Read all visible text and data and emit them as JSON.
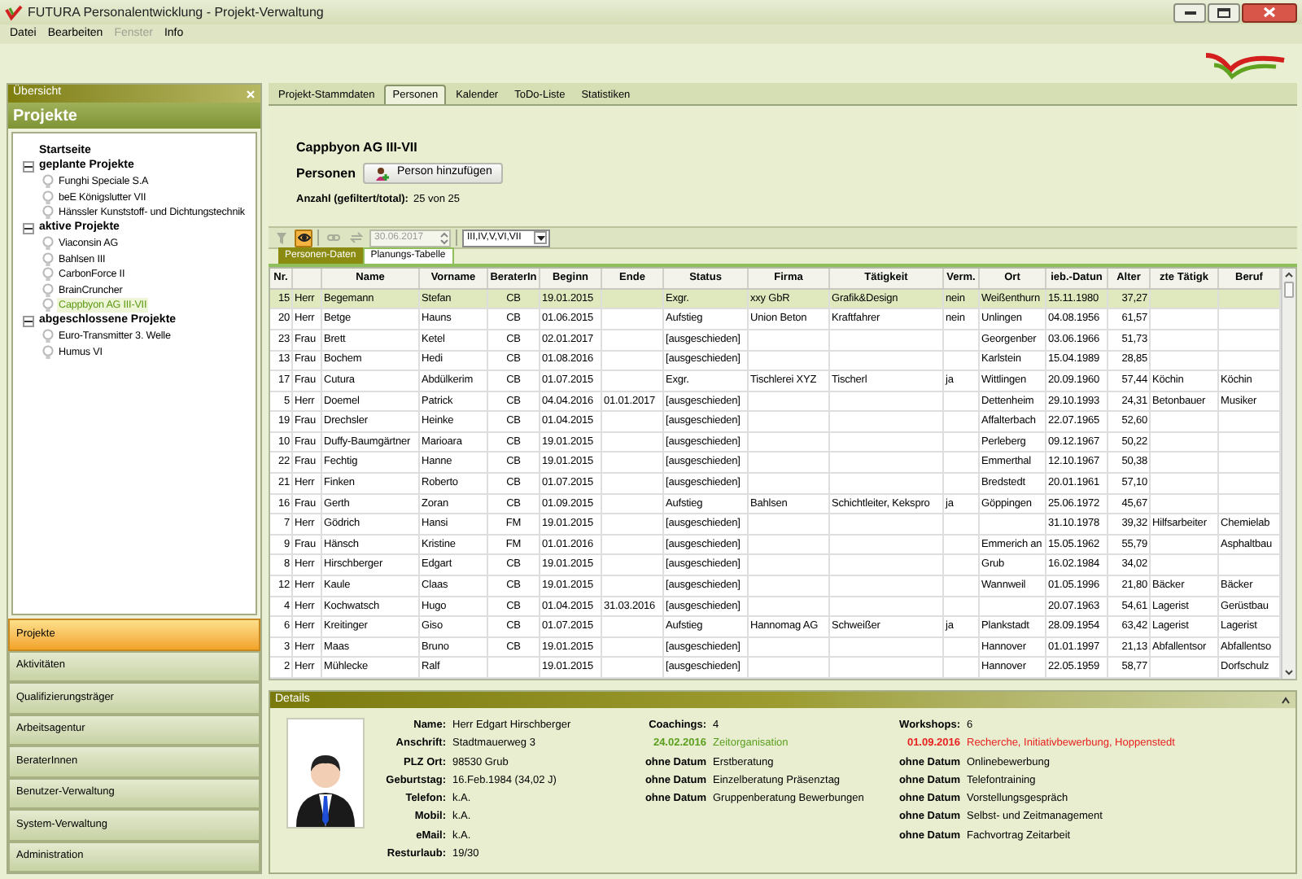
{
  "window": {
    "title": "FUTURA Personalentwicklung - Projekt-Verwaltung"
  },
  "menu": [
    {
      "label": "Datei",
      "disabled": false
    },
    {
      "label": "Bearbeiten",
      "disabled": false
    },
    {
      "label": "Fenster",
      "disabled": true
    },
    {
      "label": "Info",
      "disabled": false
    }
  ],
  "sidebar": {
    "header": "Übersicht",
    "title": "Projekte",
    "tree": [
      {
        "label": "Startseite",
        "kind": "page"
      },
      {
        "label": "geplante Projekte",
        "kind": "group",
        "expanded": true,
        "children": [
          {
            "label": "Funghi Speciale S.A",
            "selected": false
          },
          {
            "label": "beE Königslutter VII",
            "selected": false
          },
          {
            "label": "Hänssler Kunststoff- und Dichtungstechnik",
            "selected": false
          }
        ]
      },
      {
        "label": "aktive Projekte",
        "kind": "group",
        "expanded": true,
        "children": [
          {
            "label": "Viaconsin AG",
            "selected": false
          },
          {
            "label": "Bahlsen III",
            "selected": false
          },
          {
            "label": "CarbonForce II",
            "selected": false
          },
          {
            "label": "BrainCruncher",
            "selected": false
          },
          {
            "label": "Cappbyon AG III-VII",
            "selected": true
          }
        ]
      },
      {
        "label": "abgeschlossene Projekte",
        "kind": "group",
        "expanded": true,
        "children": [
          {
            "label": "Euro-Transmitter 3. Welle",
            "selected": false
          },
          {
            "label": "Humus VI",
            "selected": false
          }
        ]
      }
    ],
    "nav": [
      {
        "label": "Projekte",
        "selected": true
      },
      {
        "label": "Aktivitäten",
        "selected": false
      },
      {
        "label": "Qualifizierungsträger",
        "selected": false
      },
      {
        "label": "Arbeitsagentur",
        "selected": false
      },
      {
        "label": "BeraterInnen",
        "selected": false
      },
      {
        "label": "Benutzer-Verwaltung",
        "selected": false
      },
      {
        "label": "System-Verwaltung",
        "selected": false
      },
      {
        "label": "Administration",
        "selected": false
      }
    ]
  },
  "tabs": [
    {
      "label": "Projekt-Stammdaten",
      "selected": false
    },
    {
      "label": "Personen",
      "selected": true
    },
    {
      "label": "Kalender",
      "selected": false
    },
    {
      "label": "ToDo-Liste",
      "selected": false
    },
    {
      "label": "Statistiken",
      "selected": false
    }
  ],
  "project": {
    "title": "Cappbyon AG III-VII",
    "section": "Personen",
    "add_button": "Person hinzufügen",
    "count_label": "Anzahl (gefiltert/total):",
    "count": "25 von 25"
  },
  "toolbar": {
    "buttons": [
      {
        "kind": "filter",
        "disabled": true,
        "on": false
      },
      {
        "kind": "view",
        "disabled": false,
        "on": true
      },
      {
        "kind": "link",
        "disabled": true,
        "on": false
      },
      {
        "kind": "transfer",
        "disabled": true,
        "on": false
      }
    ],
    "date": "30.06.2017",
    "date_disabled": true,
    "phase_filter": "III,IV,V,VI,VII"
  },
  "subtabs": [
    {
      "label": "Personen-Daten",
      "selected": true
    },
    {
      "label": "Planungs-Tabelle",
      "selected": false
    }
  ],
  "table": {
    "columns": [
      "Nr.",
      "",
      "Name",
      "Vorname",
      "BeraterIn",
      "Beginn",
      "Ende",
      "Status",
      "Firma",
      "Tätigkeit",
      "Verm.",
      "Ort",
      "ieb.-Datun",
      "Alter",
      "zte Tätigk",
      "Beruf"
    ],
    "rows": [
      {
        "selected": true,
        "cells": [
          "15",
          "Herr",
          "Begemann",
          "Stefan",
          "CB",
          "19.01.2015",
          null,
          "Exgr.",
          "xxy GbR",
          "Grafik&Design",
          "nein",
          "Weißenthurn",
          "15.11.1980",
          "37,27",
          null,
          null
        ]
      },
      {
        "selected": false,
        "cells": [
          "20",
          "Herr",
          "Betge",
          "Hauns",
          "CB",
          "01.06.2015",
          null,
          "Aufstieg",
          "Union Beton",
          "Kraftfahrer",
          "nein",
          "Unlingen",
          "04.08.1956",
          "61,57",
          null,
          null
        ]
      },
      {
        "selected": false,
        "cells": [
          "23",
          "Frau",
          "Brett",
          "Ketel",
          "CB",
          "02.01.2017",
          null,
          "[ausgeschieden]",
          null,
          null,
          null,
          "Georgenber",
          "03.06.1966",
          "51,73",
          null,
          null
        ]
      },
      {
        "selected": false,
        "cells": [
          "13",
          "Frau",
          "Bochem",
          "Hedi",
          "CB",
          "01.08.2016",
          null,
          "[ausgeschieden]",
          null,
          null,
          null,
          "Karlstein",
          "15.04.1989",
          "28,85",
          null,
          null
        ]
      },
      {
        "selected": false,
        "cells": [
          "17",
          "Frau",
          "Cutura",
          "Abdülkerim",
          "CB",
          "01.07.2015",
          null,
          "Exgr.",
          "Tischlerei XYZ",
          "Tischerl",
          "ja",
          "Wittlingen",
          "20.09.1960",
          "57,44",
          "Köchin",
          "Köchin"
        ]
      },
      {
        "selected": false,
        "cells": [
          "5",
          "Herr",
          "Doemel",
          "Patrick",
          "CB",
          "04.04.2016",
          "01.01.2017",
          "[ausgeschieden]",
          null,
          null,
          null,
          "Dettenheim",
          "29.10.1993",
          "24,31",
          "Betonbauer",
          "Musiker"
        ]
      },
      {
        "selected": false,
        "cells": [
          "19",
          "Frau",
          "Drechsler",
          "Heinke",
          "CB",
          "01.04.2015",
          null,
          "[ausgeschieden]",
          null,
          null,
          null,
          "Affalterbach",
          "22.07.1965",
          "52,60",
          null,
          null
        ]
      },
      {
        "selected": false,
        "cells": [
          "10",
          "Frau",
          "Duffy-Baumgärtner",
          "Marioara",
          "CB",
          "19.01.2015",
          null,
          "[ausgeschieden]",
          null,
          null,
          null,
          "Perleberg",
          "09.12.1967",
          "50,22",
          null,
          null
        ]
      },
      {
        "selected": false,
        "cells": [
          "22",
          "Frau",
          "Fechtig",
          "Hanne",
          "CB",
          "19.01.2015",
          null,
          "[ausgeschieden]",
          null,
          null,
          null,
          "Emmerthal",
          "12.10.1967",
          "50,38",
          null,
          null
        ]
      },
      {
        "selected": false,
        "cells": [
          "21",
          "Herr",
          "Finken",
          "Roberto",
          "CB",
          "01.07.2015",
          null,
          "[ausgeschieden]",
          null,
          null,
          null,
          "Bredstedt",
          "20.01.1961",
          "57,10",
          null,
          null
        ]
      },
      {
        "selected": false,
        "cells": [
          "16",
          "Frau",
          "Gerth",
          "Zoran",
          "CB",
          "01.09.2015",
          null,
          "Aufstieg",
          "Bahlsen",
          "Schichtleiter, Kekspro",
          "ja",
          "Göppingen",
          "25.06.1972",
          "45,67",
          null,
          null
        ]
      },
      {
        "selected": false,
        "cells": [
          "7",
          "Herr",
          "Gödrich",
          "Hansi",
          "FM",
          "19.01.2015",
          null,
          "[ausgeschieden]",
          null,
          null,
          null,
          null,
          "31.10.1978",
          "39,32",
          "Hilfsarbeiter",
          "Chemielab"
        ]
      },
      {
        "selected": false,
        "cells": [
          "9",
          "Frau",
          "Hänsch",
          "Kristine",
          "FM",
          "01.01.2016",
          null,
          "[ausgeschieden]",
          null,
          null,
          null,
          "Emmerich an",
          "15.05.1962",
          "55,79",
          null,
          "Asphaltbau"
        ]
      },
      {
        "selected": false,
        "cells": [
          "8",
          "Herr",
          "Hirschberger",
          "Edgart",
          "CB",
          "19.01.2015",
          null,
          "[ausgeschieden]",
          null,
          null,
          null,
          "Grub",
          "16.02.1984",
          "34,02",
          null,
          null
        ]
      },
      {
        "selected": false,
        "cells": [
          "12",
          "Herr",
          "Kaule",
          "Claas",
          "CB",
          "19.01.2015",
          null,
          "[ausgeschieden]",
          null,
          null,
          null,
          "Wannweil",
          "01.05.1996",
          "21,80",
          "Bäcker",
          "Bäcker"
        ]
      },
      {
        "selected": false,
        "cells": [
          "4",
          "Herr",
          "Kochwatsch",
          "Hugo",
          "CB",
          "01.04.2015",
          "31.03.2016",
          "[ausgeschieden]",
          null,
          null,
          null,
          null,
          "20.07.1963",
          "54,61",
          "Lagerist",
          "Gerüstbau"
        ]
      },
      {
        "selected": false,
        "cells": [
          "6",
          "Herr",
          "Kreitinger",
          "Giso",
          "CB",
          "01.07.2015",
          null,
          "Aufstieg",
          "Hannomag AG",
          "Schweißer",
          "ja",
          "Plankstadt",
          "28.09.1954",
          "63,42",
          "Lagerist",
          "Lagerist"
        ]
      },
      {
        "selected": false,
        "cells": [
          "3",
          "Herr",
          "Maas",
          "Bruno",
          "CB",
          "19.01.2015",
          null,
          "[ausgeschieden]",
          null,
          null,
          null,
          "Hannover",
          "01.01.1997",
          "21,13",
          "Abfallentsor",
          "Abfallentso"
        ]
      },
      {
        "selected": false,
        "cells": [
          "2",
          "Herr",
          "Mühlecke",
          "Ralf",
          null,
          "19.01.2015",
          null,
          "[ausgeschieden]",
          null,
          null,
          null,
          "Hannover",
          "22.05.1959",
          "58,77",
          null,
          "Dorfschulz"
        ]
      }
    ]
  },
  "details": {
    "title": "Details",
    "fields": [
      {
        "label": "Name:",
        "value": "Herr Edgart Hirschberger"
      },
      {
        "label": "Anschrift:",
        "value": "Stadtmauerweg 3"
      },
      {
        "label": "PLZ Ort:",
        "value": "98530 Grub"
      },
      {
        "label": "Geburtstag:",
        "value": "16.Feb.1984 (34,02 J)"
      },
      {
        "label": "Telefon:",
        "value": "k.A."
      },
      {
        "label": "Mobil:",
        "value": "k.A."
      },
      {
        "label": "eMail:",
        "value": "k.A."
      },
      {
        "label": "Resturlaub:",
        "value": "19/30"
      }
    ],
    "coachings": {
      "label": "Coachings:",
      "count": "4",
      "items": [
        {
          "date": "24.02.2016",
          "text": "Zeitorganisation",
          "color": "#5a9e1e"
        },
        {
          "date": "ohne Datum",
          "text": "Erstberatung",
          "color": "#000000"
        },
        {
          "date": "ohne Datum",
          "text": "Einzelberatung Präsenztag",
          "color": "#000000"
        },
        {
          "date": "ohne Datum",
          "text": "Gruppenberatung Bewerbungen",
          "color": "#000000"
        }
      ]
    },
    "workshops": {
      "label": "Workshops:",
      "count": "6",
      "items": [
        {
          "date": "01.09.2016",
          "text": "Recherche, Initiativbewerbung, Hoppenstedt",
          "color": "#e8201e"
        },
        {
          "date": "ohne Datum",
          "text": "Onlinebewerbung",
          "color": "#000000"
        },
        {
          "date": "ohne Datum",
          "text": "Telefontraining",
          "color": "#000000"
        },
        {
          "date": "ohne Datum",
          "text": "Vorstellungsgespräch",
          "color": "#000000"
        },
        {
          "date": "ohne Datum",
          "text": "Selbst- und Zeitmanagement",
          "color": "#000000"
        },
        {
          "date": "ohne Datum",
          "text": "Fachvortrag Zeitarbeit",
          "color": "#000000"
        }
      ]
    }
  }
}
